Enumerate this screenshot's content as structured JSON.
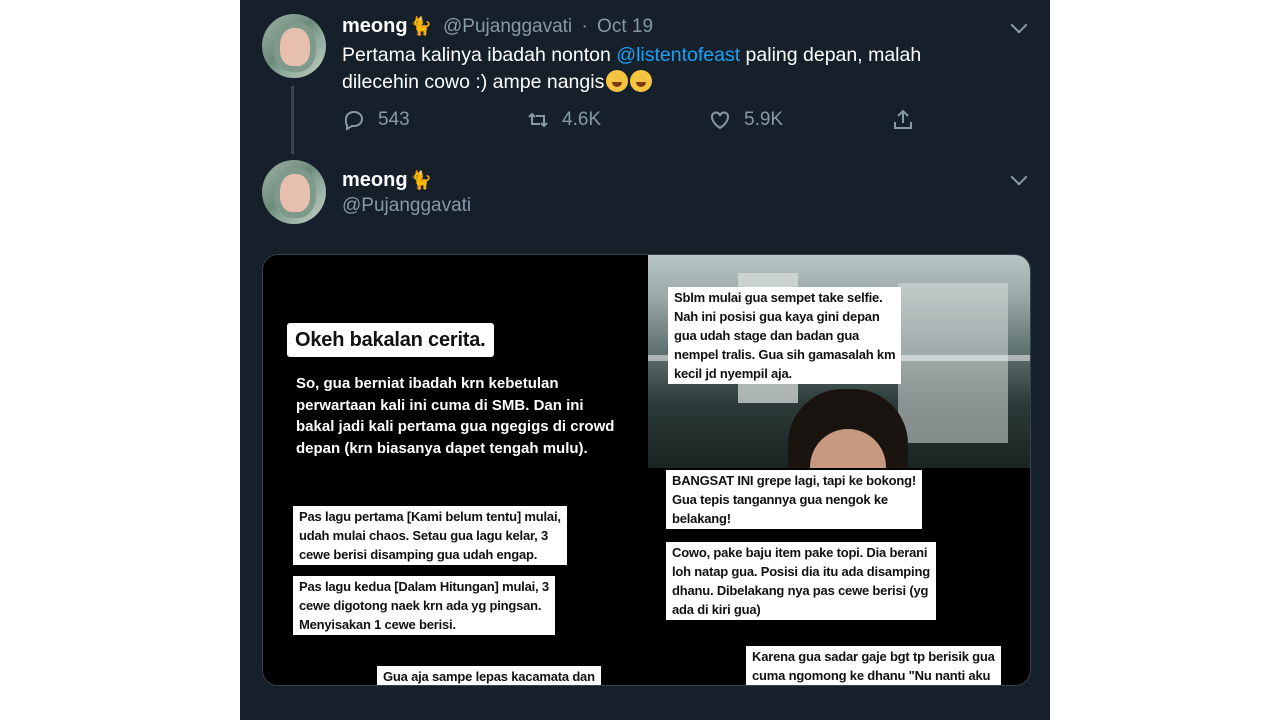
{
  "tweet1": {
    "name": "meong",
    "handle": "@Pujanggavati",
    "separator": "·",
    "date": "Oct 19",
    "text_before": "Pertama kalinya ibadah nonton ",
    "mention": "@listentofeast",
    "text_after": " paling depan, malah dilecehin cowo :) ampe nangis",
    "replies": "543",
    "retweets": "4.6K",
    "likes": "5.9K"
  },
  "tweet2": {
    "name": "meong",
    "handle": "@Pujanggavati"
  },
  "media": {
    "c1_title": "Okeh bakalan cerita.",
    "c1_body": [
      "So, gua berniat ibadah krn kebetulan",
      "perwartaan kali ini cuma di SMB. Dan ini",
      "bakal jadi kali pertama gua ngegigs di crowd",
      "depan (krn biasanya dapet tengah mulu)."
    ],
    "c2_caption": [
      "Sblm mulai gua sempet take selfie.",
      "Nah ini posisi gua kaya gini depan",
      "gua udah stage dan badan gua",
      "nempel tralis. Gua sih gamasalah km",
      "kecil jd nyempil aja."
    ],
    "c3_p1": [
      "Pas lagu pertama [Kami belum tentu] mulai,",
      "udah mulai chaos. Setau gua lagu kelar, 3",
      "cewe berisi disamping gua udah engap."
    ],
    "c3_p2": [
      "Pas lagu kedua  [Dalam Hitungan]  mulai, 3",
      "cewe digotong naek krn ada yg pingsan.",
      "Menyisakan 1 cewe berisi."
    ],
    "c3_p3": "Gua aja sampe lepas kacamata dan",
    "c4_p1": [
      "BANGSAT INI grepe lagi, tapi ke bokong!",
      "Gua tepis tangannya gua nengok ke",
      "belakang!"
    ],
    "c4_p2": [
      "Cowo, pake baju item pake topi. Dia berani",
      "loh natap gua. Posisi dia itu ada disamping",
      "dhanu. Dibelakang nya pas cewe berisi (yg",
      "ada di kiri gua)"
    ],
    "c4_p3": [
      "Karena gua sadar gaje bgt tp berisik gua",
      "cuma ngomong ke dhanu \"Nu nanti aku"
    ]
  },
  "colors": {
    "background": "#15202b",
    "accent": "#1da1f2",
    "muted": "#8899a6"
  },
  "icons": [
    "chevron-down-icon",
    "reply-icon",
    "retweet-icon",
    "like-icon",
    "share-icon",
    "cat-emoji",
    "crying-emoji"
  ]
}
